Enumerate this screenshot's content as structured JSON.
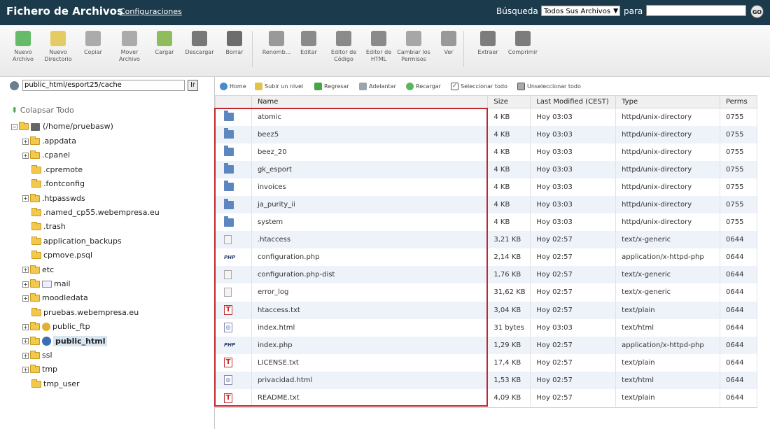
{
  "header": {
    "title": "Fichero de Archivos",
    "config_link": "Configuraciones",
    "search_label": "Búsqueda",
    "search_scope": "Todos Sus Archivos",
    "para_label": "para",
    "search_value": "",
    "go_label": "GO"
  },
  "toolbar": {
    "items": [
      {
        "label": "Nuevo Archivo",
        "icon": "new-file-icon"
      },
      {
        "label": "Nuevo Directorio",
        "icon": "new-folder-icon"
      },
      {
        "label": "Copiar",
        "icon": "copy-icon"
      },
      {
        "label": "Mover Archivo",
        "icon": "move-icon"
      },
      {
        "label": "Cargar",
        "icon": "upload-icon"
      },
      {
        "label": "Descargar",
        "icon": "download-icon"
      },
      {
        "label": "Borrar",
        "icon": "delete-icon"
      },
      {
        "label": "Renomb...",
        "icon": "rename-icon"
      },
      {
        "label": "Editar",
        "icon": "edit-icon"
      },
      {
        "label": "Editor de Código",
        "icon": "code-editor-icon"
      },
      {
        "label": "Editor de HTML",
        "icon": "html-editor-icon"
      },
      {
        "label": "Cambiar los Permisos",
        "icon": "permissions-icon"
      },
      {
        "label": "Ver",
        "icon": "view-icon"
      },
      {
        "label": "Extraer",
        "icon": "extract-icon"
      },
      {
        "label": "Comprimir",
        "icon": "compress-icon"
      }
    ]
  },
  "left": {
    "path_value": "public_html/esport25/cache",
    "go_button": "Ir",
    "collapse_label": "Colapsar Todo",
    "root_label": "(/home/pruebasw)",
    "tree": [
      {
        "label": ".appdata",
        "plus": true
      },
      {
        "label": ".cpanel",
        "plus": true
      },
      {
        "label": ".cpremote",
        "plus": false
      },
      {
        "label": ".fontconfig",
        "plus": false
      },
      {
        "label": ".htpasswds",
        "plus": true
      },
      {
        "label": ".named_cp55.webempresa.eu",
        "plus": false
      },
      {
        "label": ".trash",
        "plus": false
      },
      {
        "label": "application_backups",
        "plus": false
      },
      {
        "label": "cpmove.psql",
        "plus": false
      },
      {
        "label": "etc",
        "plus": true
      },
      {
        "label": "mail",
        "plus": true
      },
      {
        "label": "moodledata",
        "plus": true
      },
      {
        "label": "pruebas.webempresa.eu",
        "plus": false
      },
      {
        "label": "public_ftp",
        "plus": true
      },
      {
        "label": "public_html",
        "plus": true
      },
      {
        "label": "ssl",
        "plus": true
      },
      {
        "label": "tmp",
        "plus": true
      },
      {
        "label": "tmp_user",
        "plus": false
      }
    ]
  },
  "nav": {
    "home": "Home",
    "up": "Subir un nivel",
    "back": "Regresar",
    "forward": "Adelantar",
    "reload": "Recargar",
    "select_all": "Seleccionar todo",
    "unselect_all": "Unseleccionar todo"
  },
  "table": {
    "headers": [
      "Name",
      "Size",
      "Last Modified (CEST)",
      "Type",
      "Perms"
    ],
    "rows": [
      {
        "icon": "dir",
        "name": "atomic",
        "size": "4 KB",
        "modified": "Hoy 03:03",
        "type": "httpd/unix-directory",
        "perms": "0755"
      },
      {
        "icon": "dir",
        "name": "beez5",
        "size": "4 KB",
        "modified": "Hoy 03:03",
        "type": "httpd/unix-directory",
        "perms": "0755"
      },
      {
        "icon": "dir",
        "name": "beez_20",
        "size": "4 KB",
        "modified": "Hoy 03:03",
        "type": "httpd/unix-directory",
        "perms": "0755"
      },
      {
        "icon": "dir",
        "name": "gk_esport",
        "size": "4 KB",
        "modified": "Hoy 03:03",
        "type": "httpd/unix-directory",
        "perms": "0755"
      },
      {
        "icon": "dir",
        "name": "invoices",
        "size": "4 KB",
        "modified": "Hoy 03:03",
        "type": "httpd/unix-directory",
        "perms": "0755"
      },
      {
        "icon": "dir",
        "name": "ja_purity_ii",
        "size": "4 KB",
        "modified": "Hoy 03:03",
        "type": "httpd/unix-directory",
        "perms": "0755"
      },
      {
        "icon": "dir",
        "name": "system",
        "size": "4 KB",
        "modified": "Hoy 03:03",
        "type": "httpd/unix-directory",
        "perms": "0755"
      },
      {
        "icon": "generic",
        "name": ".htaccess",
        "size": "3,21 KB",
        "modified": "Hoy 02:57",
        "type": "text/x-generic",
        "perms": "0644"
      },
      {
        "icon": "php",
        "name": "configuration.php",
        "size": "2,14 KB",
        "modified": "Hoy 02:57",
        "type": "application/x-httpd-php",
        "perms": "0644"
      },
      {
        "icon": "generic",
        "name": "configuration.php-dist",
        "size": "1,76 KB",
        "modified": "Hoy 02:57",
        "type": "text/x-generic",
        "perms": "0644"
      },
      {
        "icon": "generic",
        "name": "error_log",
        "size": "31,62 KB",
        "modified": "Hoy 02:57",
        "type": "text/x-generic",
        "perms": "0644"
      },
      {
        "icon": "txt",
        "name": "htaccess.txt",
        "size": "3,04 KB",
        "modified": "Hoy 02:57",
        "type": "text/plain",
        "perms": "0644"
      },
      {
        "icon": "html",
        "name": "index.html",
        "size": "31 bytes",
        "modified": "Hoy 03:03",
        "type": "text/html",
        "perms": "0644"
      },
      {
        "icon": "php",
        "name": "index.php",
        "size": "1,29 KB",
        "modified": "Hoy 02:57",
        "type": "application/x-httpd-php",
        "perms": "0644"
      },
      {
        "icon": "txt",
        "name": "LICENSE.txt",
        "size": "17,4 KB",
        "modified": "Hoy 02:57",
        "type": "text/plain",
        "perms": "0644"
      },
      {
        "icon": "html",
        "name": "privacidad.html",
        "size": "1,53 KB",
        "modified": "Hoy 02:57",
        "type": "text/html",
        "perms": "0644"
      },
      {
        "icon": "txt",
        "name": "README.txt",
        "size": "4,09 KB",
        "modified": "Hoy 02:57",
        "type": "text/plain",
        "perms": "0644"
      }
    ]
  }
}
